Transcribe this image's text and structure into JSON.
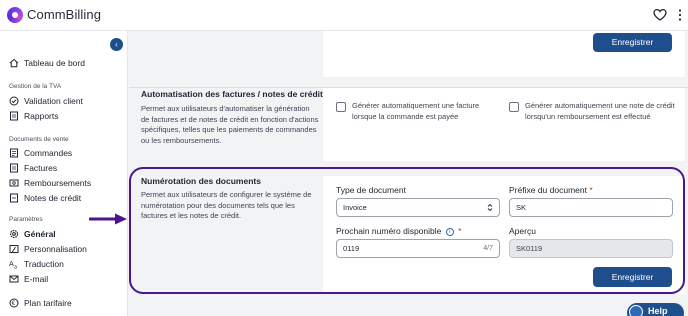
{
  "brand": {
    "name": "CommBilling"
  },
  "sidebar": {
    "collapse_label": "‹",
    "items_top": [
      {
        "label": "Tableau de bord",
        "icon": "home-icon"
      }
    ],
    "section_tva": "Gestion de la TVA",
    "items_tva": [
      {
        "label": "Validation client",
        "icon": "badge-check-icon"
      },
      {
        "label": "Rapports",
        "icon": "report-icon"
      }
    ],
    "section_docs": "Documents de vente",
    "items_docs": [
      {
        "label": "Commandes",
        "icon": "order-icon"
      },
      {
        "label": "Factures",
        "icon": "invoice-icon"
      },
      {
        "label": "Remboursements",
        "icon": "refund-icon"
      },
      {
        "label": "Notes de crédit",
        "icon": "credit-note-icon"
      }
    ],
    "section_params": "Paramètres",
    "items_params": [
      {
        "label": "Général",
        "icon": "gear-icon",
        "active": true
      },
      {
        "label": "Personnalisation",
        "icon": "customize-icon"
      },
      {
        "label": "Traduction",
        "icon": "translate-icon"
      },
      {
        "label": "E-mail",
        "icon": "mail-icon"
      }
    ],
    "plan_label": "Plan tarifaire"
  },
  "top_card": {
    "save_label": "Enregistrer"
  },
  "automation": {
    "title": "Automatisation des factures / notes de crédit",
    "description": "Permet aux utilisateurs d'automatiser la génération de factures et de notes de crédit en fonction d'actions spécifiques, telles que les paiements de commandes ou les remboursements.",
    "option1": "Générer automatiquement une facture lorsque la commande est payée",
    "option2": "Générer automatiquement une note de crédit lorsqu'un remboursement est effectué"
  },
  "numbering": {
    "title": "Numérotation des documents",
    "description": "Permet aux utilisateurs de configurer le système de numérotation pour des documents tels que les factures et les notes de crédit.",
    "doc_type_label": "Type de document",
    "doc_type_value": "Invoice",
    "prefix_label": "Préfixe du document",
    "prefix_value": "SK",
    "next_number_label": "Prochain numéro disponible",
    "next_number_value": "0119",
    "next_number_counter": "4/7",
    "preview_label": "Aperçu",
    "preview_value": "SK0119",
    "required_mark": "*",
    "save_label": "Enregistrer"
  },
  "help": {
    "label": "Help"
  },
  "colors": {
    "primary": "#1f4e8c",
    "highlight": "#4a178f",
    "required": "#c0392b"
  }
}
